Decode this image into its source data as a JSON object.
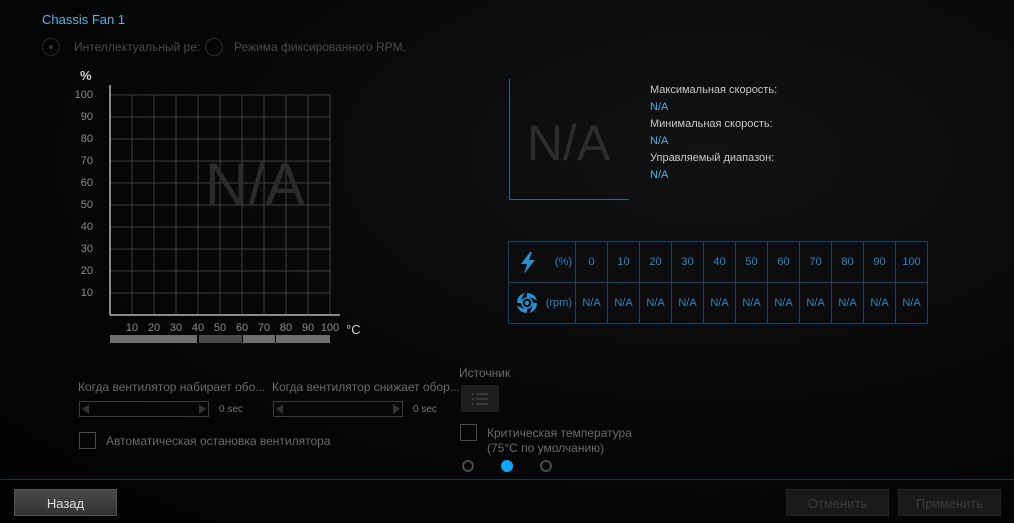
{
  "header": {
    "title": "Chassis Fan 1"
  },
  "mode": {
    "options": [
      {
        "label": "Интеллектуальный ре:",
        "selected": true
      },
      {
        "label": "Режима фиксированного RPM.",
        "selected": false
      }
    ]
  },
  "curve": {
    "y_unit": "%",
    "x_unit": "°C",
    "y_ticks": [
      "100",
      "90",
      "80",
      "70",
      "60",
      "50",
      "40",
      "30",
      "20",
      "10"
    ],
    "x_ticks": [
      "10",
      "20",
      "30",
      "40",
      "50",
      "60",
      "70",
      "80",
      "90",
      "100"
    ],
    "placeholder": "N/A",
    "temp_zones": [
      {
        "from": 0,
        "to": 40,
        "color": "#6e6e6e"
      },
      {
        "from": 40,
        "to": 60,
        "color": "#4a4a4a"
      },
      {
        "from": 60,
        "to": 75,
        "color": "#6e6e6e"
      },
      {
        "from": 75,
        "to": 100,
        "color": "#6e6e6e"
      }
    ]
  },
  "rpm_info": {
    "placeholder": "N/A",
    "max_label": "Максимальная скорость:",
    "max_value": "N/A",
    "min_label": "Минимальная скорость:",
    "min_value": "N/A",
    "range_label": "Управляемый диапазон:",
    "range_value": "N/A"
  },
  "table": {
    "row1": {
      "icon": "lightning-icon",
      "unit": "(%)",
      "values": [
        "0",
        "10",
        "20",
        "30",
        "40",
        "50",
        "60",
        "70",
        "80",
        "90",
        "100"
      ]
    },
    "row2": {
      "icon": "fan-icon",
      "unit": "(rpm)",
      "values": [
        "N/A",
        "N/A",
        "N/A",
        "N/A",
        "N/A",
        "N/A",
        "N/A",
        "N/A",
        "N/A",
        "N/A",
        "N/A"
      ]
    }
  },
  "controls": {
    "spin_up_label": "Когда вентилятор набирает обо...",
    "spin_up_value": "0 sec",
    "spin_down_label": "Когда вентилятор снижает обор...",
    "spin_down_value": "0 sec",
    "auto_stop_label": "Автоматическая остановка вентилятора",
    "source_label": "Источник",
    "critical_label_1": "Критическая температура",
    "critical_label_2": "(75°C по умолчанию)"
  },
  "pager": {
    "count": 3,
    "active": 2
  },
  "footer": {
    "back": "Назад",
    "cancel": "Отменить",
    "apply": "Применить"
  }
}
